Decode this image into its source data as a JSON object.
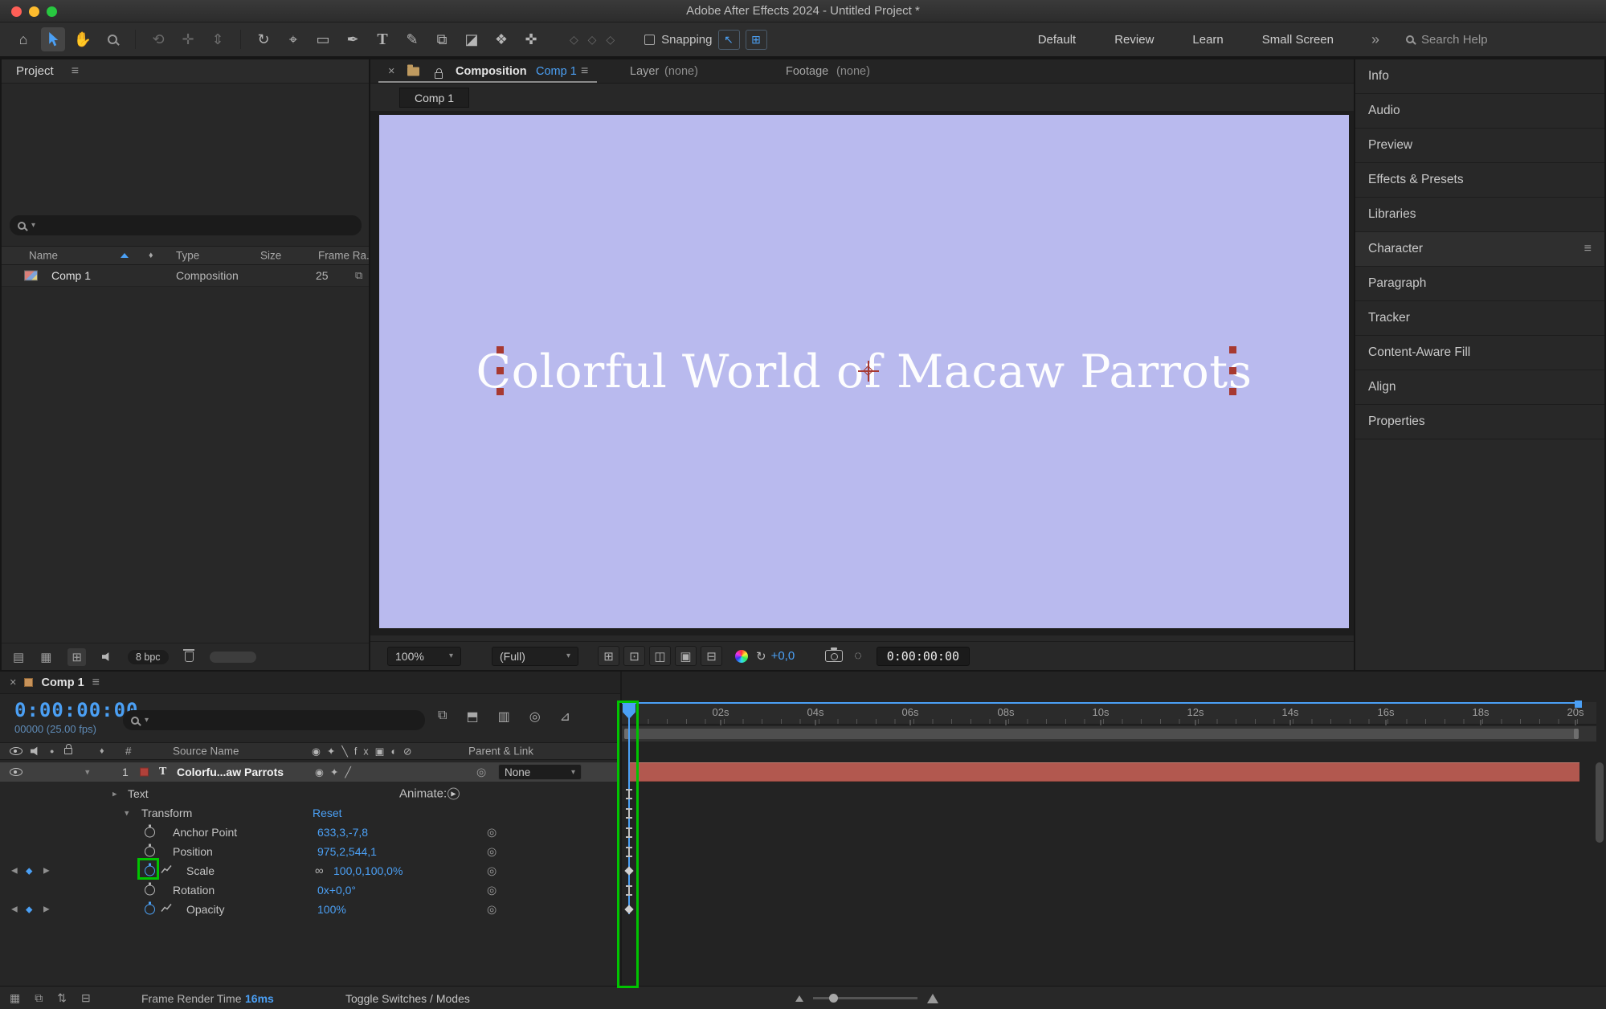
{
  "window": {
    "title": "Adobe After Effects 2024 - Untitled Project *"
  },
  "toolbar": {
    "snapping_label": "Snapping",
    "workspaces": [
      "Default",
      "Review",
      "Learn",
      "Small Screen"
    ],
    "search_placeholder": "Search Help"
  },
  "icons": {
    "home": "⌂",
    "hand": "✋",
    "orbit": "⟲",
    "pan_camera": "✛",
    "dolly": "⇕",
    "rotation": "↻",
    "pan_behind": "⌖",
    "rectangle": "▭",
    "pen": "✒",
    "type_tool": "T",
    "brush": "✎",
    "clone_stamp": "⧉",
    "eraser": "◪",
    "roto_brush": "❖",
    "puppet": "✜",
    "axis_modes": "◇ ◇ ◇",
    "snap_1": "↖",
    "snap_2": "⊞",
    "overflow": "»",
    "close": "×",
    "menu": "≡",
    "caret_down": "▾",
    "caret_right": "▸",
    "label_flag": "♦",
    "hash": "#",
    "solo": "●",
    "switch_row": "◉✦╲fx▣◐⊘",
    "layer_switch_row": "◉✦╱",
    "flowchart": "⧉",
    "draft3d": "⬒",
    "frame_blend": "▥",
    "motion_blur": "◎",
    "graph_editor": "⊿",
    "roi": "⊞",
    "grid": "⊡",
    "layout": "◫",
    "mask": "▣",
    "rulers": "⊟",
    "pickwhip": "◎",
    "chain": "∞",
    "play": "▶",
    "refresh": "↻",
    "snapshot": "◌",
    "sb_1": "▦",
    "sb_2": "⧉",
    "sb_3": "⇅",
    "sb_4": "⊟",
    "pv_1": "▤",
    "pv_2": "▦",
    "pv_3": "⊞",
    "net": "⧉",
    "kf_prev": "◀",
    "kf_next": "▶",
    "kf_diamond": "◆"
  },
  "project_panel": {
    "title": "Project",
    "columns": [
      "Name",
      "Type",
      "Size",
      "Frame Ra..."
    ],
    "row": {
      "name": "Comp 1",
      "type": "Composition",
      "size": "25"
    },
    "bit_depth": "8 bpc"
  },
  "viewer": {
    "tab_composition": "Composition",
    "tab_composition_target": "Comp 1",
    "tab_layer": "Layer",
    "tab_layer_target": "(none)",
    "tab_footage": "Footage",
    "tab_footage_target": "(none)",
    "comp_tab": "Comp 1",
    "canvas_text": "Colorful World of Macaw Parrots",
    "zoom": "100%",
    "resolution": "(Full)",
    "exposure": "+0,0",
    "time": "0:00:00:00"
  },
  "right_panel": {
    "items": [
      "Info",
      "Audio",
      "Preview",
      "Effects & Presets",
      "Libraries",
      "Character",
      "Paragraph",
      "Tracker",
      "Content-Aware Fill",
      "Align",
      "Properties"
    ]
  },
  "timeline": {
    "tab": "Comp 1",
    "current_time": "0:00:00:00",
    "frame_info": "00000 (25.00 fps)",
    "source_name_col": "Source Name",
    "parent_link_col": "Parent & Link",
    "layer": {
      "index": "1",
      "type_badge": "T",
      "name": "Colorfu...aw Parrots",
      "parent": "None"
    },
    "text_group": {
      "label": "Text",
      "action": "Animate:"
    },
    "transform_group": {
      "label": "Transform",
      "action": "Reset"
    },
    "properties": [
      {
        "label": "Anchor Point",
        "value": "633,3,-7,8"
      },
      {
        "label": "Position",
        "value": "975,2,544,1"
      },
      {
        "label": "Scale",
        "value": "100,0,100,0%"
      },
      {
        "label": "Rotation",
        "value": "0x+0,0°"
      },
      {
        "label": "Opacity",
        "value": "100%"
      }
    ],
    "ruler_ticks": [
      "02s",
      "04s",
      "06s",
      "08s",
      "10s",
      "12s",
      "14s",
      "16s",
      "18s",
      "20s"
    ]
  },
  "status_bar": {
    "render_time_label": "Frame Render Time",
    "render_time_value": "16ms",
    "toggle_label": "Toggle Switches / Modes"
  }
}
